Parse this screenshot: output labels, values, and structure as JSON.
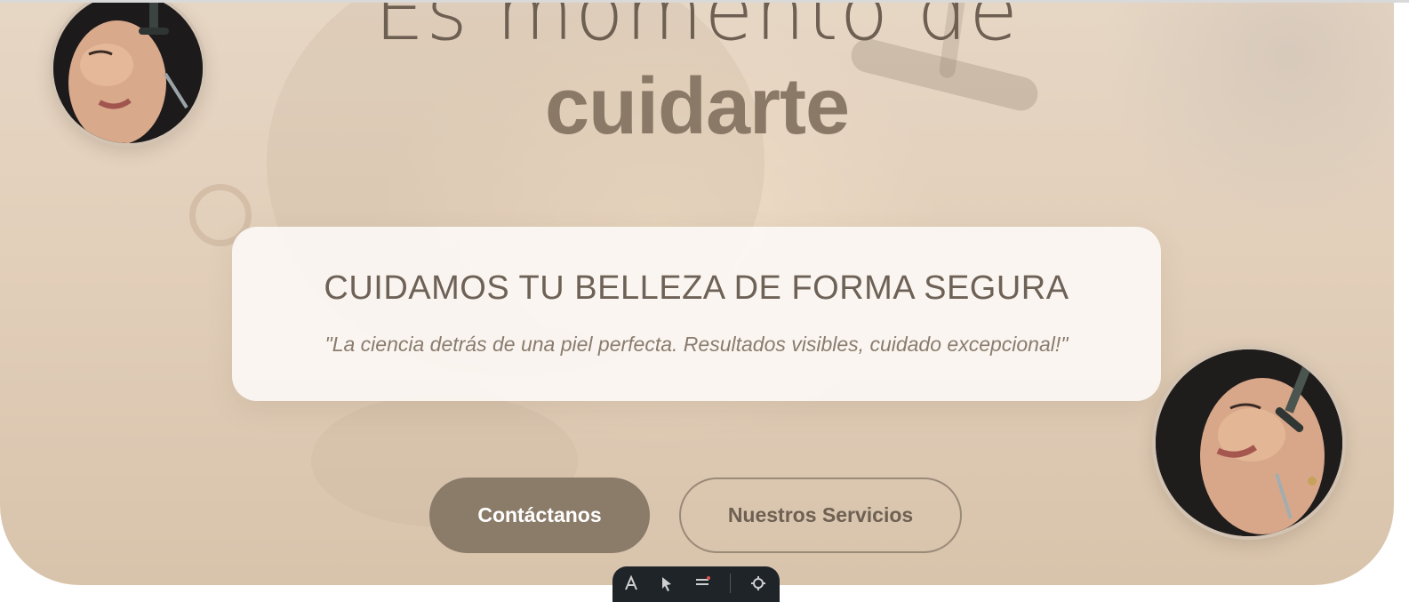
{
  "hero": {
    "title_line1": "Es momento de",
    "title_line2": "cuidarte"
  },
  "card": {
    "heading": "CUIDAMOS TU BELLEZA DE FORMA SEGURA",
    "quote": "\"La ciencia detrás de una piel perfecta. Resultados visibles, cuidado excepcional!\""
  },
  "buttons": {
    "primary_label": "Contáctanos",
    "secondary_label": "Nuestros Servicios"
  },
  "toolbar": {
    "icons": [
      "text-icon",
      "pointer-icon",
      "menu-icon",
      "settings-icon"
    ]
  },
  "colors": {
    "hero_bg": "#e2cfba",
    "title_light": "#6d5f52",
    "title_bold": "#8a7967",
    "primary_button": "#8b7b69",
    "toolbar_bg": "#1f2429"
  }
}
